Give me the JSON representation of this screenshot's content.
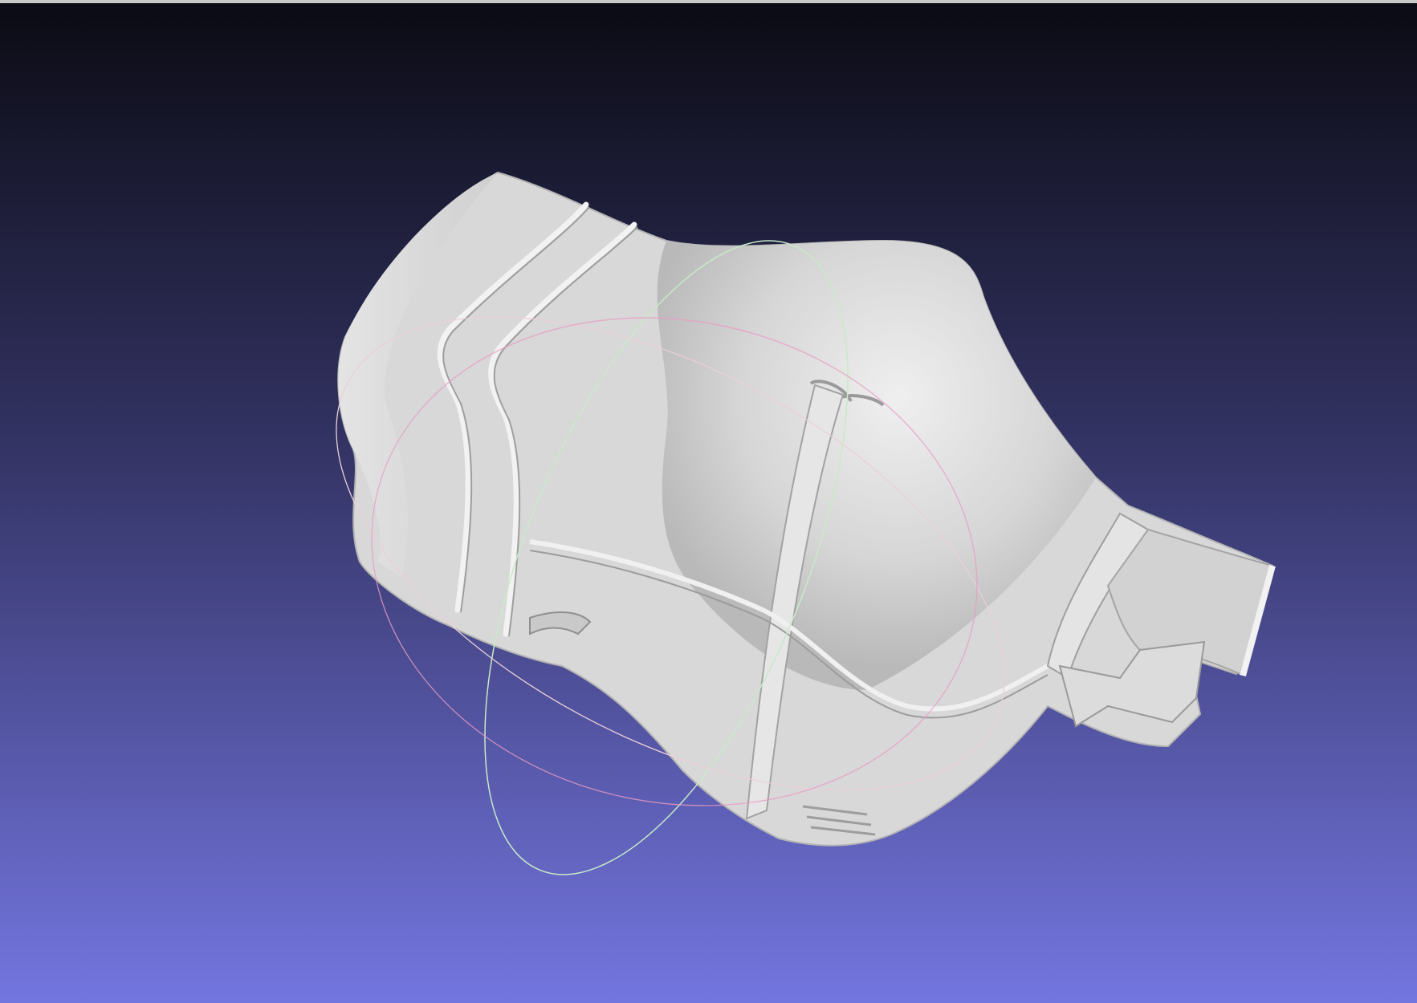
{
  "viewport": {
    "background_top": "#0b0b14",
    "background_mid": "#343466",
    "background_bottom": "#7476e0",
    "model_color": "#d9d9d9",
    "model_shadow": "#a9a9a9",
    "model_highlight": "#eeeeee",
    "trackball": {
      "x_ring_color": "#c8eac8",
      "y_ring_color": "#ead0d8",
      "z_ring_color": "#e89cc0"
    }
  }
}
